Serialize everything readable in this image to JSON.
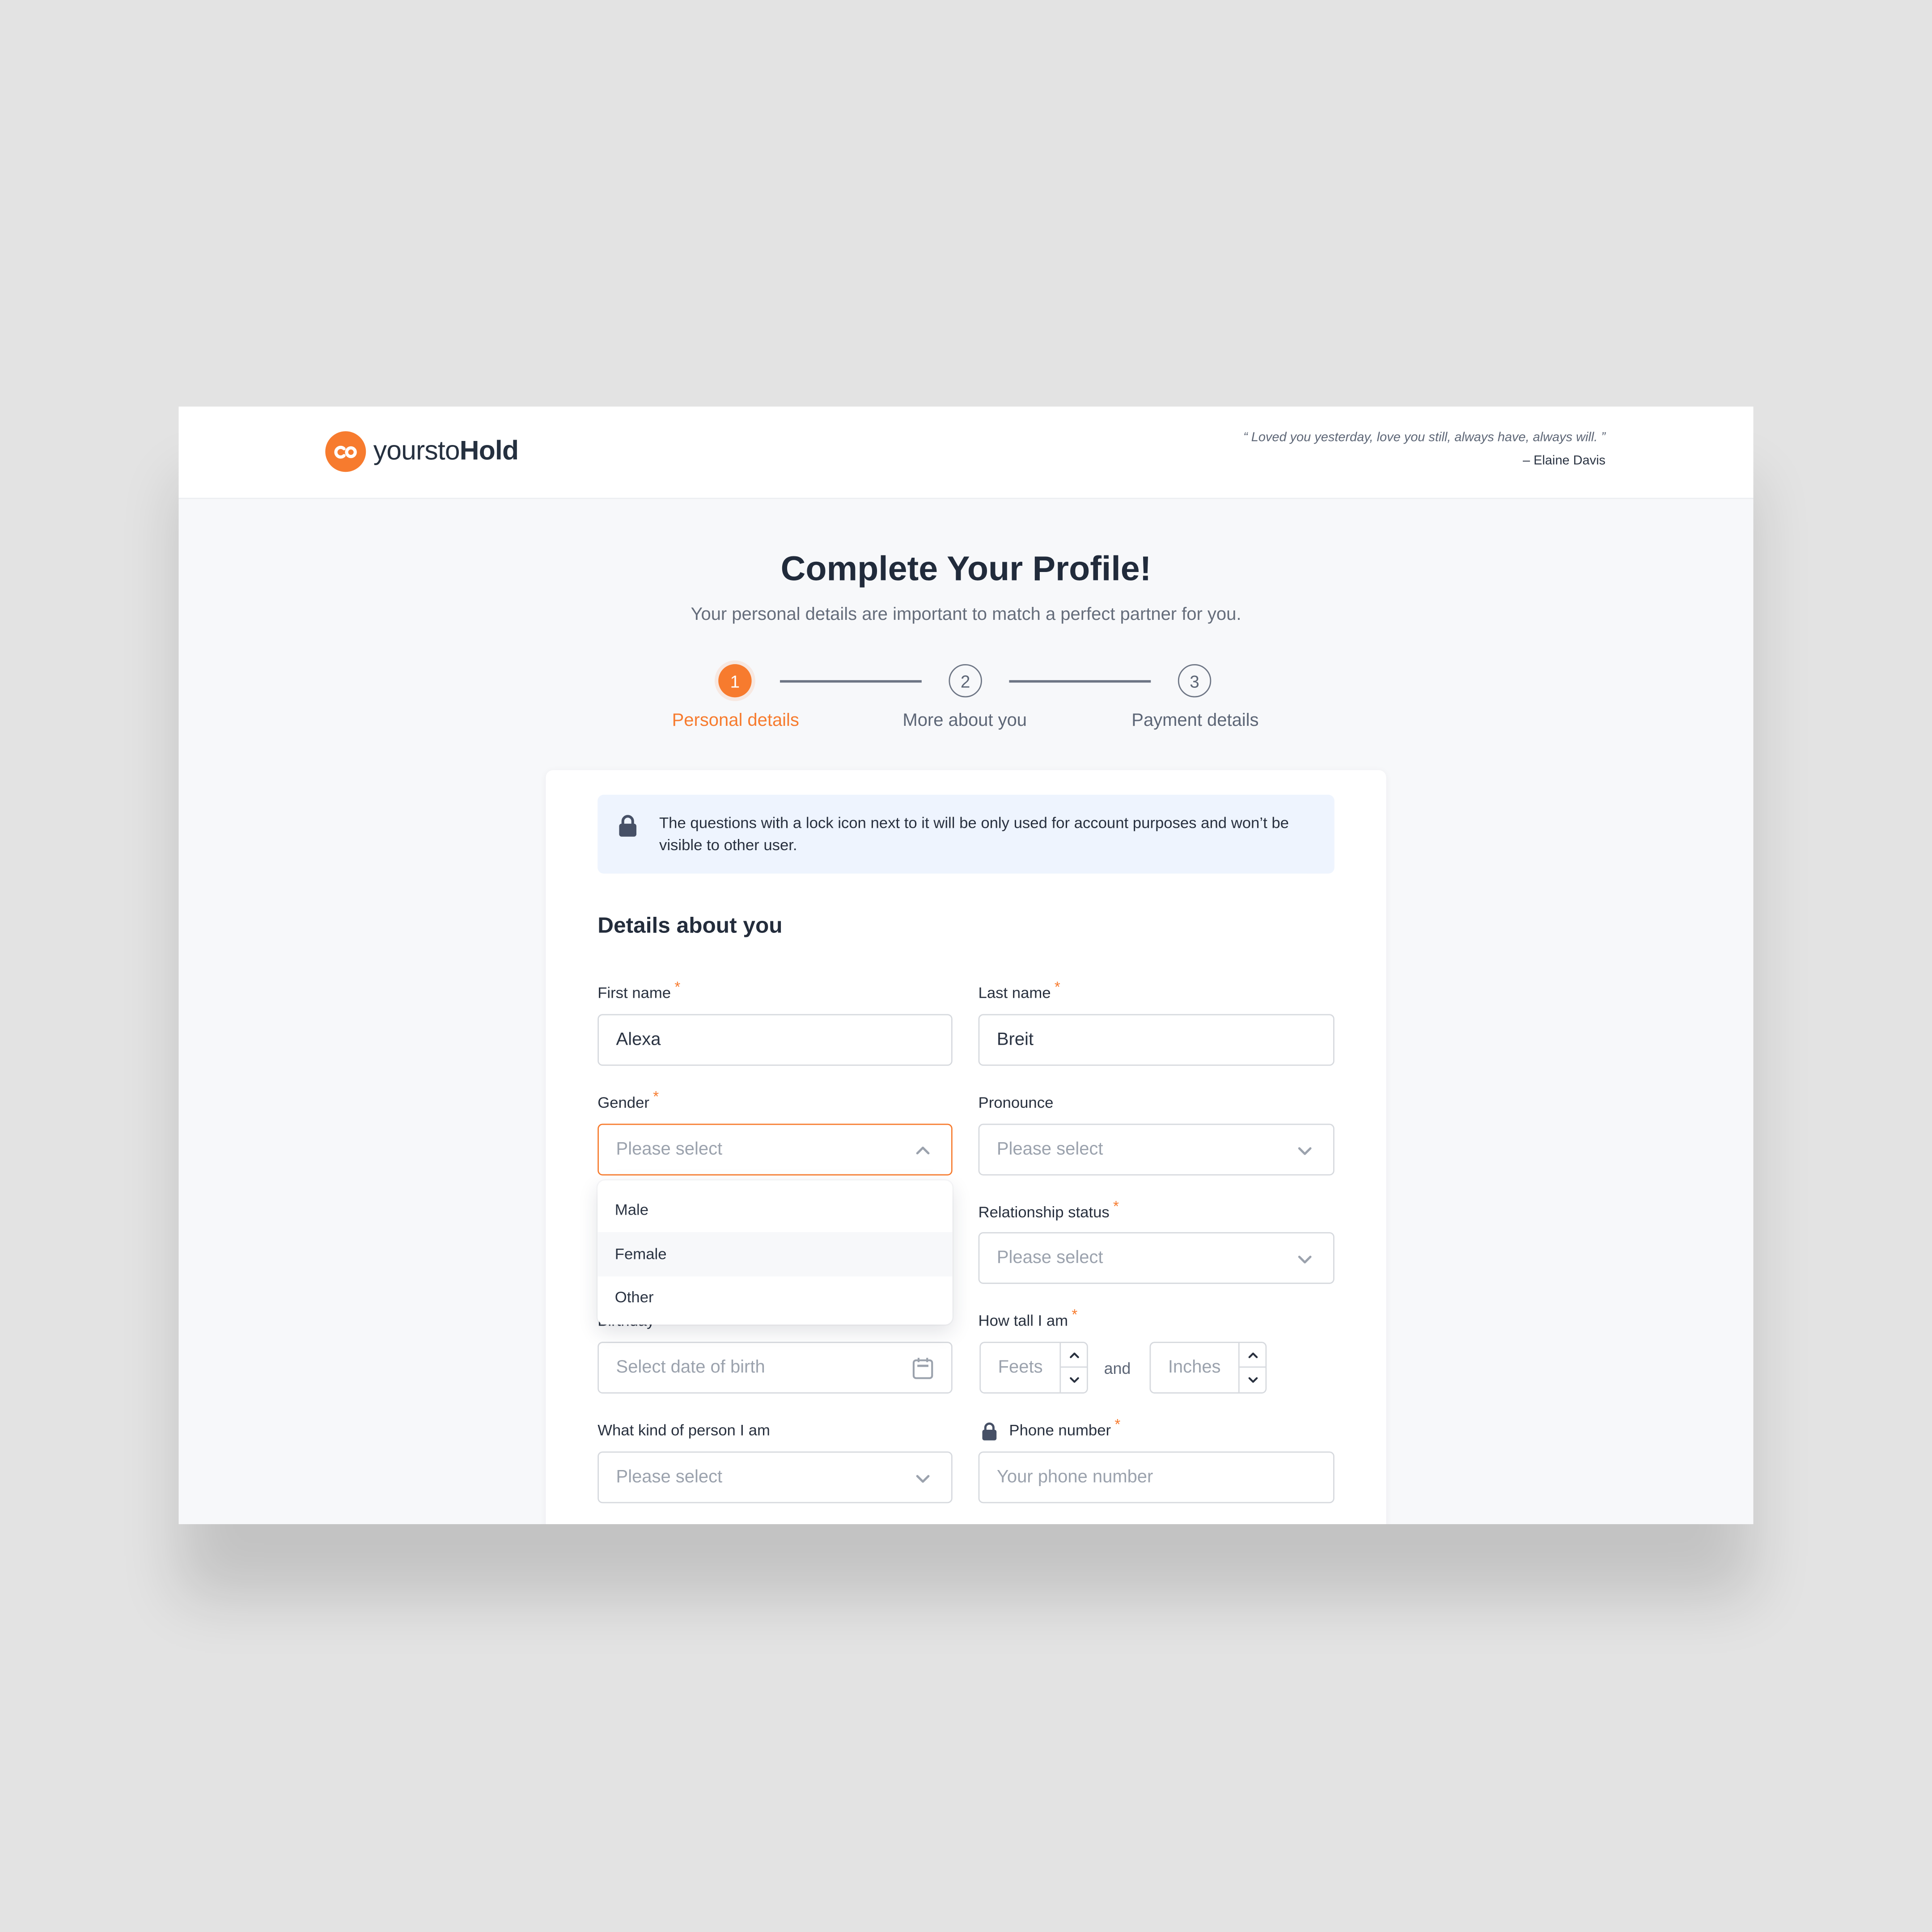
{
  "brand": {
    "name_light": "yoursto",
    "name_bold": "Hold",
    "accent_color": "#f77b2e"
  },
  "header": {
    "quote": "“ Loved you yesterday, love you still, always have, always will. ”",
    "author": "– Elaine Davis"
  },
  "page": {
    "title": "Complete Your Profile!",
    "subtitle": "Your personal details are important to match a perfect partner for you."
  },
  "steps": [
    {
      "number": "1",
      "label": "Personal details",
      "state": "active"
    },
    {
      "number": "2",
      "label": "More about you",
      "state": "upcoming"
    },
    {
      "number": "3",
      "label": "Payment details",
      "state": "upcoming"
    }
  ],
  "notice": {
    "icon": "lock-icon",
    "text": "The questions with a lock icon next to it will be only used for account purposes and won’t be visible to other user."
  },
  "form": {
    "section_title": "Details about you",
    "required_marker": "*",
    "first_name": {
      "label": "First name",
      "value": "Alexa",
      "required": true
    },
    "last_name": {
      "label": "Last name",
      "value": "Breit",
      "required": true
    },
    "gender": {
      "label": "Gender",
      "placeholder": "Please select",
      "required": true,
      "open": true,
      "options": [
        "Male",
        "Female",
        "Other"
      ],
      "highlighted": "Female"
    },
    "pronoun": {
      "label": "Pronounce",
      "placeholder": "Please select",
      "required": false
    },
    "relationship": {
      "label": "Relationship status",
      "placeholder": "Please select",
      "required": true
    },
    "birthday": {
      "label": "Birthday",
      "placeholder": "Select date of birth",
      "required": false
    },
    "height": {
      "label": "How tall I am",
      "required": true,
      "feet_placeholder": "Feets",
      "joiner": "and",
      "inches_placeholder": "Inches"
    },
    "person_kind": {
      "label": "What kind of person I am",
      "placeholder": "Please select",
      "required": false
    },
    "phone": {
      "label": "Phone number",
      "placeholder": "Your phone number",
      "required": true,
      "private": true
    }
  }
}
